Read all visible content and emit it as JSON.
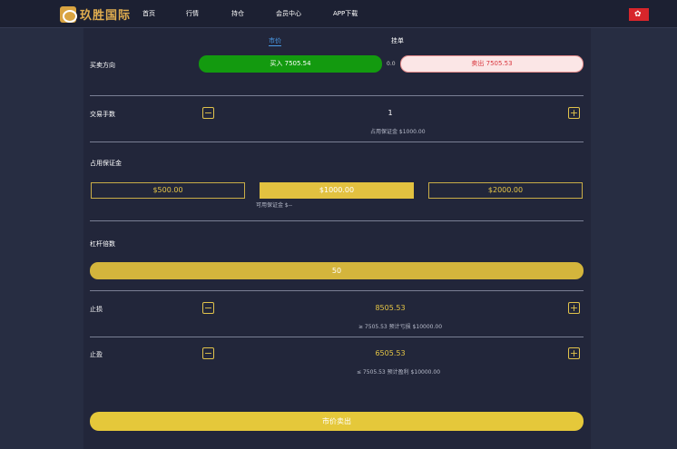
{
  "header": {
    "brand": "玖胜国际",
    "nav": [
      "首页",
      "行情",
      "持仓",
      "会员中心",
      "APP下载"
    ]
  },
  "tabs": [
    "市价",
    "挂单"
  ],
  "direction": {
    "label": "买卖方向",
    "buy": "买入 7505.54",
    "spread": "0.0",
    "sell": "卖出 7505.53"
  },
  "lots": {
    "label": "交易手数",
    "value": "1",
    "note": "占用保证金 $1000.00"
  },
  "margin": {
    "label": "占用保证金",
    "options": [
      "$500.00",
      "$1000.00",
      "$2000.00"
    ],
    "selected_index": 1,
    "available": "可用保证金 $--"
  },
  "leverage": {
    "label": "杠杆倍数",
    "value": "50"
  },
  "stop_loss": {
    "label": "止损",
    "value": "8505.53",
    "note": "≥ 7505.53 预计亏损 $10000.00"
  },
  "take_profit": {
    "label": "止盈",
    "value": "6505.53",
    "note": "≤ 7505.53 预计盈利 $10000.00"
  },
  "submit_label": "市价卖出",
  "colors": {
    "buy": "#139a0f",
    "sell_text": "#d9363e",
    "accent_gold": "#e2c140",
    "tab_active": "#4a9be8"
  }
}
